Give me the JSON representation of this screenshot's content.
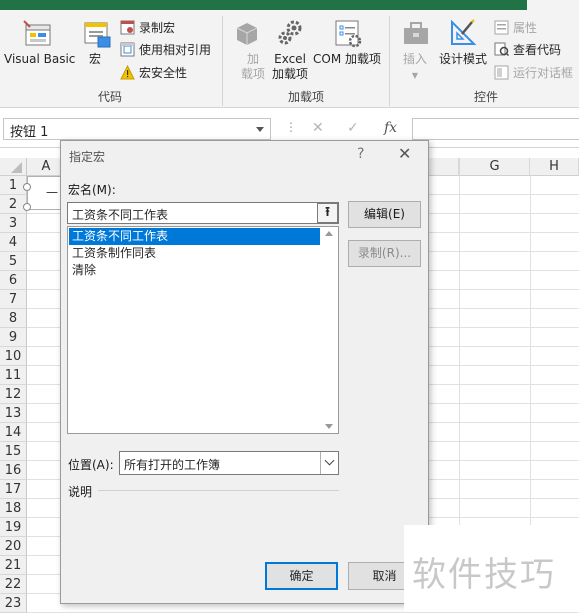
{
  "ribbon": {
    "groups": {
      "code": "代码",
      "addins": "加载项",
      "controls": "控件"
    },
    "visual_basic": "Visual Basic",
    "macros": "宏",
    "record_macro": "录制宏",
    "relative_ref": "使用相对引用",
    "macro_security": "宏安全性",
    "addins_line1": "加",
    "addins_line2": "载项",
    "excel_addins_line1": "Excel",
    "excel_addins_line2": "加载项",
    "com_addins": "COM 加载项",
    "insert": "插入",
    "design_mode": "设计模式",
    "properties": "属性",
    "view_code": "查看代码",
    "run_dialog": "运行对话框"
  },
  "formula_bar": {
    "name_box": "按钮 1",
    "cancel": "✕",
    "enter": "✓",
    "fx": "fx"
  },
  "grid": {
    "columns": [
      "A",
      "G",
      "H"
    ],
    "rows": [
      "1",
      "2",
      "3",
      "4",
      "5",
      "6",
      "7",
      "8",
      "9",
      "10",
      "11",
      "12",
      "13",
      "14",
      "15",
      "16",
      "17",
      "18",
      "19",
      "20",
      "21",
      "22",
      "23"
    ],
    "cell_a1": "—"
  },
  "dialog": {
    "title": "指定宏",
    "help": "?",
    "close": "✕",
    "macro_name_label": "宏名(M):",
    "macro_name_value": "工资条不同工作表",
    "macros": [
      "工资条不同工作表",
      "工资条制作同表",
      "清除"
    ],
    "selected_index": 0,
    "edit_button": "编辑(E)",
    "record_button": "录制(R)...",
    "location_label": "位置(A):",
    "location_value": "所有打开的工作簿",
    "description_label": "说明",
    "ok_button": "确定",
    "cancel_button": "取消"
  },
  "watermark": "软件技巧",
  "colors": {
    "excel_green": "#217346",
    "selection_blue": "#0078d7"
  }
}
